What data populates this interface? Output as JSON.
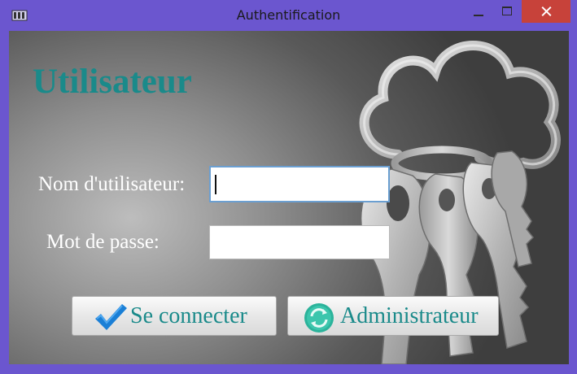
{
  "window": {
    "title": "Authentification"
  },
  "form": {
    "heading": "Utilisateur",
    "username_label": "Nom d'utilisateur:",
    "username_value": "",
    "password_label": "Mot de passe:",
    "password_value": ""
  },
  "buttons": {
    "login_label": "Se connecter",
    "admin_label": "Administrateur"
  },
  "icons": {
    "app": "app-window-icon",
    "login": "checkmark-icon",
    "admin": "refresh-icon",
    "background": "keys-illustration"
  },
  "colors": {
    "accent": "#1a8a8a",
    "window_frame": "#6b56cf",
    "close": "#c7423a",
    "check": "#1a7fd6"
  }
}
